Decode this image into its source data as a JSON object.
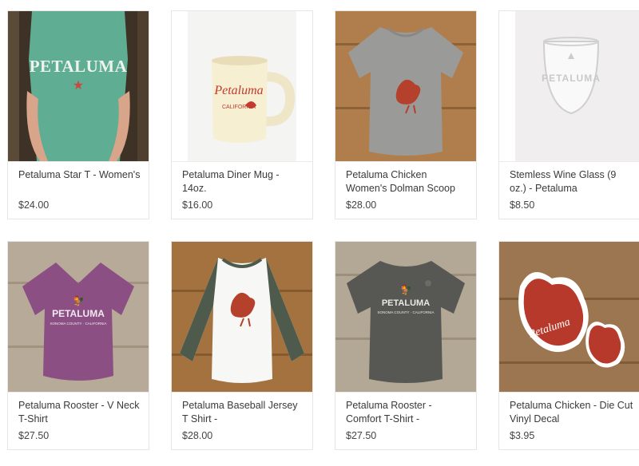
{
  "products": [
    {
      "name": "Petaluma Star T - Women's",
      "price": "$24.00",
      "image_text": "PETALUMA"
    },
    {
      "name": "Petaluma Diner Mug - 14oz.",
      "price": "$16.00",
      "image_text": "Petaluma"
    },
    {
      "name": "Petaluma Chicken Women's Dolman Scoop",
      "price": "$28.00"
    },
    {
      "name": "Stemless Wine Glass (9 oz.) - Petaluma",
      "price": "$8.50",
      "image_text": "PETALUMA"
    },
    {
      "name": "Petaluma Rooster - V Neck T-Shirt",
      "price": "$27.50",
      "image_text": "PETALUMA"
    },
    {
      "name": "Petaluma Baseball Jersey T Shirt -",
      "price": "$28.00"
    },
    {
      "name": "Petaluma Rooster - Comfort T-Shirt -",
      "price": "$27.50",
      "image_text": "PETALUMA"
    },
    {
      "name": "Petaluma Chicken - Die Cut Vinyl Decal",
      "price": "$3.95",
      "image_text": "Petaluma"
    }
  ]
}
